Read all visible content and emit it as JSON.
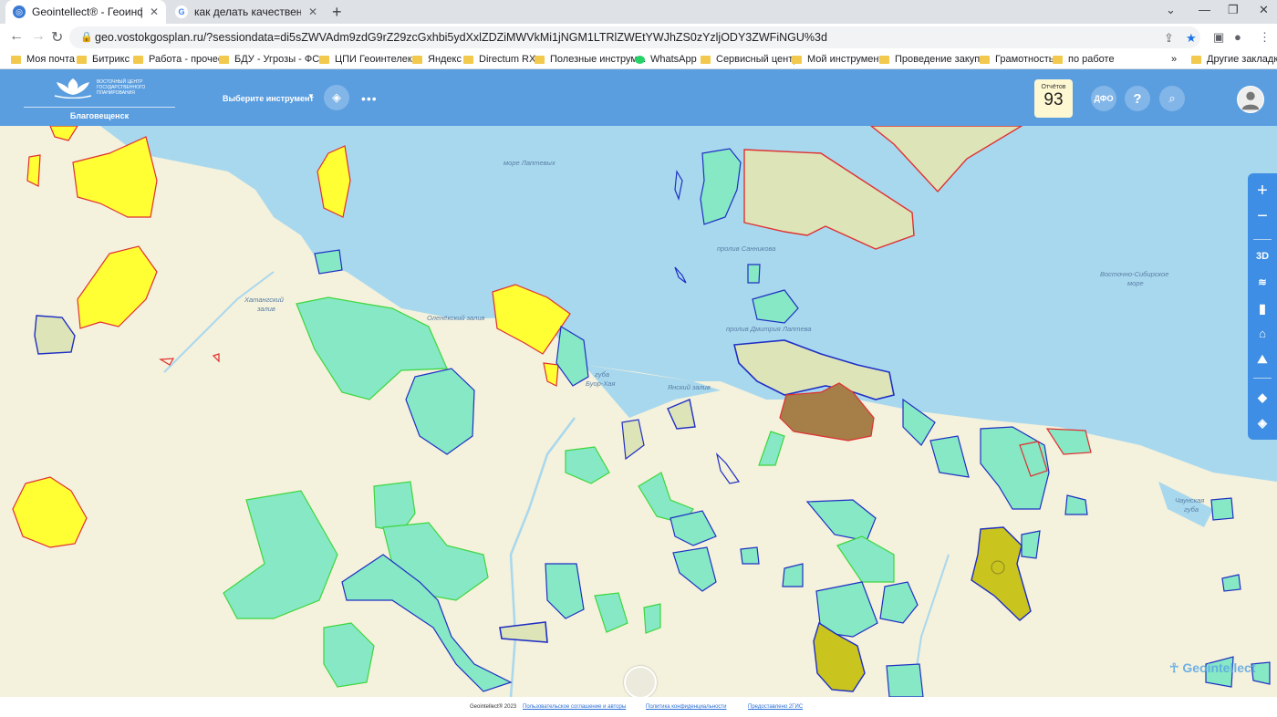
{
  "browser": {
    "tabs": [
      {
        "title": "Geointellect® - Геоинформацио",
        "close": "✕"
      },
      {
        "title": "как делать качественные сним",
        "close": "✕"
      }
    ],
    "new_tab": "+",
    "url": "geo.vostokgosplan.ru/?sessiondata=di5sZWVAdm9zdG9rZ29zcGxhbi5ydXxlZDZiMWVkMi1jNGM1LTRlZWEtYWJhZS0zYzljODY3ZWFiNGU%3d",
    "bookmarks": [
      "Моя почта",
      "Битрикс",
      "Работа - прочее",
      "БДУ - Угрозы - ФС...",
      "ЦПИ Геоинтелект",
      "Яндекс",
      "Directum RX",
      "Полезные инструм...",
      "WhatsApp",
      "Сервисный центр",
      "Мой инструмент",
      "Проведение закуп...",
      "Грамотность",
      "по работе"
    ],
    "other_bookmarks": "Другие закладки",
    "more_bookmarks": "»"
  },
  "header": {
    "logo_text": "ВОСТОЧНЫЙ ЦЕНТР ГОСУДАРСТВЕННОГО ПЛАНИРОВАНИЯ",
    "city": "Благовещенск",
    "tool_select": "Выберите инструмент",
    "reports_label": "Отчётов",
    "reports_count": "93",
    "dfo_label": "ДФО",
    "help": "?"
  },
  "map_labels": {
    "laptev_sea": "море Лаптевых",
    "sannikov_strait": "пролив Санникова",
    "east_siberian_sea_1": "Восточно-Сибирское",
    "east_siberian_sea_2": "море",
    "khatanga_1": "Хатангский",
    "khatanga_2": "залив",
    "olenek": "Оленёкский залив",
    "laptev_strait": "пролив Дмитрия Лаптева",
    "yansky": "Янский залив",
    "buor_khaya_1": "губа",
    "buor_khaya_2": "Буор-Хая",
    "chaun_1": "Чаунская",
    "chaun_2": "губа"
  },
  "right_toolbar": {
    "zoom_in": "+",
    "zoom_out": "−",
    "mode_3d": "3D"
  },
  "watermark": "Geointellect",
  "footer": {
    "copyright": "Geointellect® 2023",
    "terms": "Пользовательское соглашение и авторы",
    "privacy": "Политика конфиденциальности",
    "provided": "Предоставлено 2ГИС"
  },
  "colors": {
    "header": "#5a9ee0",
    "sea": "#a8d8ee",
    "land": "#f4f1dc",
    "teal_fill": "#86e8c4",
    "yellow_fill": "#ffff33",
    "olive_fill": "#c9c41e",
    "brown_fill": "#a57e48",
    "blue_border": "#1f2fc4",
    "red_border": "#e03030",
    "green_border": "#3ed63e"
  }
}
